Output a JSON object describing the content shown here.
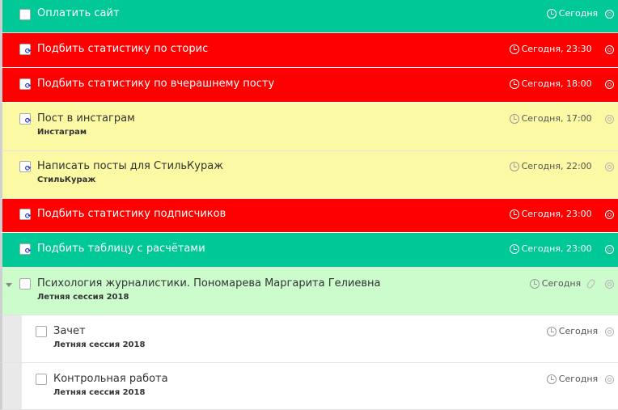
{
  "colors": {
    "green": "#00c896",
    "red": "#ff0000",
    "yellow": "#fbf9a3",
    "light_green": "#ccfccc",
    "white": "#ffffff",
    "muted": "#b5b5b5"
  },
  "tasks": [
    {
      "title": "Оплатить сайт",
      "due": "Сегодня",
      "row_style": "green",
      "repeat": false
    },
    {
      "title": "Подбить статистику по сторис",
      "due": "Сегодня, 23:30",
      "row_style": "red",
      "repeat": true
    },
    {
      "title": "Подбить статистику по вчерашнему посту",
      "due": "Сегодня, 18:00",
      "row_style": "red",
      "repeat": true
    },
    {
      "title": "Пост в инстаграм",
      "project": "Инстаграм",
      "due": "Сегодня, 17:00",
      "row_style": "yellow",
      "repeat": true
    },
    {
      "title": "Написать посты для СтильКураж",
      "project": "СтильКураж",
      "due": "Сегодня, 22:00",
      "row_style": "yellow",
      "repeat": true
    },
    {
      "title": "Подбить статистику подписчиков",
      "due": "Сегодня, 23:00",
      "row_style": "red",
      "repeat": true
    },
    {
      "title": "Подбить таблицу с расчётами",
      "due": "Сегодня, 23:00",
      "row_style": "green",
      "repeat": true
    },
    {
      "title": "Психология журналистики. Пономарева Маргарита Гелиевна",
      "project": "Летняя сессия 2018",
      "due": "Сегодня",
      "row_style": "light_green",
      "repeat": false,
      "expanded": true,
      "attachment_icon": "paperclip-icon"
    },
    {
      "title": "Зачет",
      "project": "Летняя сессия 2018",
      "due": "Сегодня",
      "row_style": "white",
      "repeat": false,
      "subtask": true
    },
    {
      "title": "Контрольная работа",
      "project": "Летняя сессия 2018",
      "due": "Сегодня",
      "row_style": "white",
      "repeat": false,
      "subtask": true
    }
  ],
  "icons": {
    "checkbox": "checkbox-icon",
    "repeat": "repeat-icon",
    "due": "clock-icon",
    "focus": "target-icon",
    "expand": "expand-arrow-icon"
  }
}
